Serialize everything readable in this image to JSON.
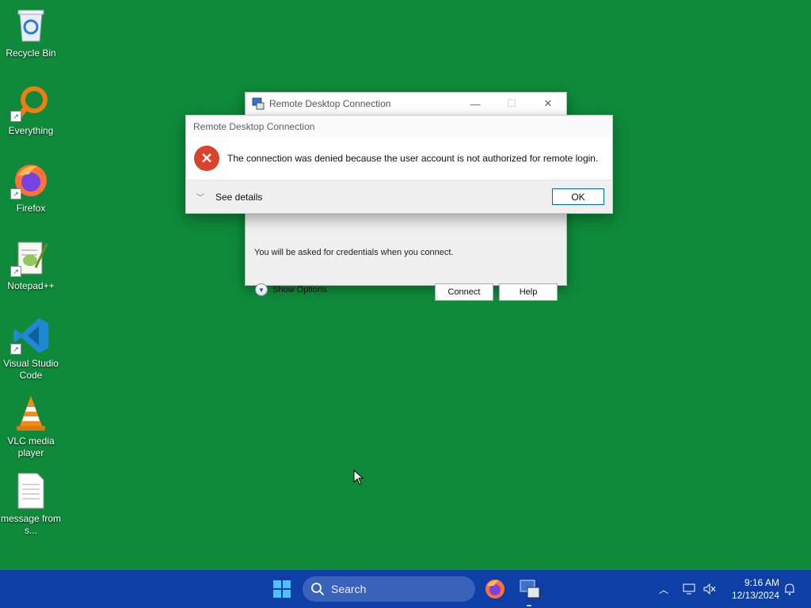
{
  "desktop": {
    "icons": [
      {
        "label": "Recycle Bin"
      },
      {
        "label": "Everything"
      },
      {
        "label": "Firefox"
      },
      {
        "label": "Notepad++"
      },
      {
        "label": "Visual Studio Code"
      },
      {
        "label": "VLC media player"
      },
      {
        "label": "message from s..."
      }
    ]
  },
  "rdp_window": {
    "title": "Remote Desktop Connection",
    "credentials_note": "You will be asked for credentials when you connect.",
    "show_options": "Show Options",
    "connect": "Connect",
    "help": "Help"
  },
  "error_dialog": {
    "title": "Remote Desktop Connection",
    "message": "The connection was denied because the user account is not authorized for remote login.",
    "see_details": "See details",
    "ok": "OK"
  },
  "taskbar": {
    "search_placeholder": "Search",
    "time": "9:16 AM",
    "date": "12/13/2024"
  },
  "colors": {
    "desktop_bg": "#0e8a3a",
    "taskbar_bg": "#0d3fa6",
    "error_red": "#d9432b",
    "accent": "#0067c0"
  }
}
